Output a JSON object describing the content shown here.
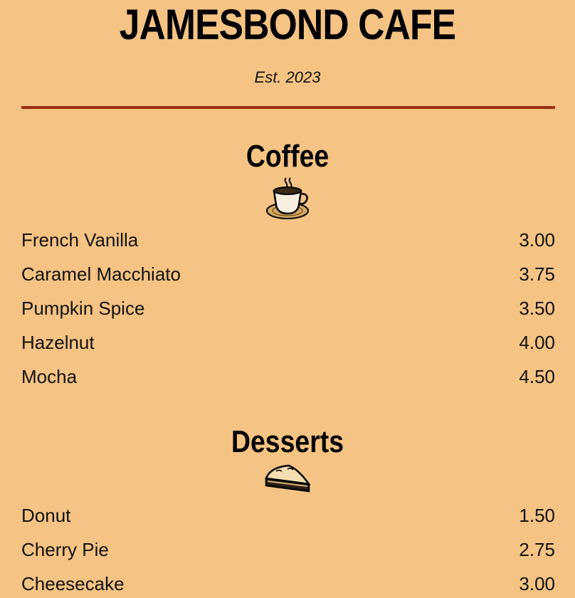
{
  "header": {
    "title": "JAMESBOND CAFE",
    "established": "Est. 2023"
  },
  "colors": {
    "background": "#f5c383",
    "divider": "#9b2d13",
    "text": "#111111"
  },
  "sections": [
    {
      "title": "Coffee",
      "icon": "coffee-cup-icon",
      "items": [
        {
          "name": "French Vanilla",
          "price": "3.00"
        },
        {
          "name": "Caramel Macchiato",
          "price": "3.75"
        },
        {
          "name": "Pumpkin Spice",
          "price": "3.50"
        },
        {
          "name": "Hazelnut",
          "price": "4.00"
        },
        {
          "name": "Mocha",
          "price": "4.50"
        }
      ]
    },
    {
      "title": "Desserts",
      "icon": "pie-slice-icon",
      "items": [
        {
          "name": "Donut",
          "price": "1.50"
        },
        {
          "name": "Cherry Pie",
          "price": "2.75"
        },
        {
          "name": "Cheesecake",
          "price": "3.00"
        }
      ]
    }
  ]
}
